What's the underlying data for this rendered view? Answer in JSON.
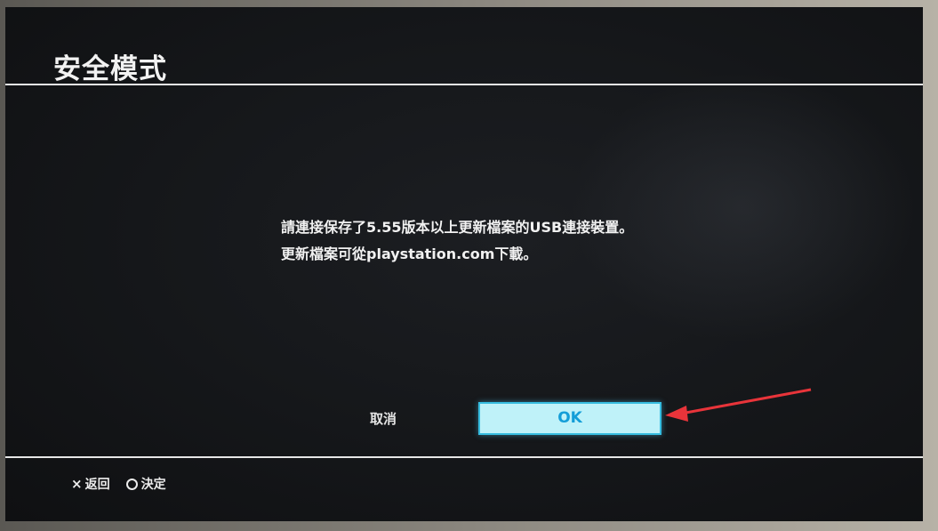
{
  "screen": {
    "title": "安全模式",
    "message": {
      "line1": "請連接保存了5.55版本以上更新檔案的USB連接裝置。",
      "line2": "更新檔案可從playstation.com下載。"
    },
    "buttons": {
      "cancel_label": "取消",
      "ok_label": "OK"
    },
    "footer": {
      "back_icon": "cross-icon",
      "back_label": "返回",
      "confirm_icon": "circle-icon",
      "confirm_label": "決定"
    }
  },
  "colors": {
    "background": "#16181b",
    "text": "#f1f1f1",
    "ok_fill": "#bff2f9",
    "ok_border": "#36bde0",
    "ok_text": "#139ed8",
    "annotation_arrow": "#e8343a"
  }
}
